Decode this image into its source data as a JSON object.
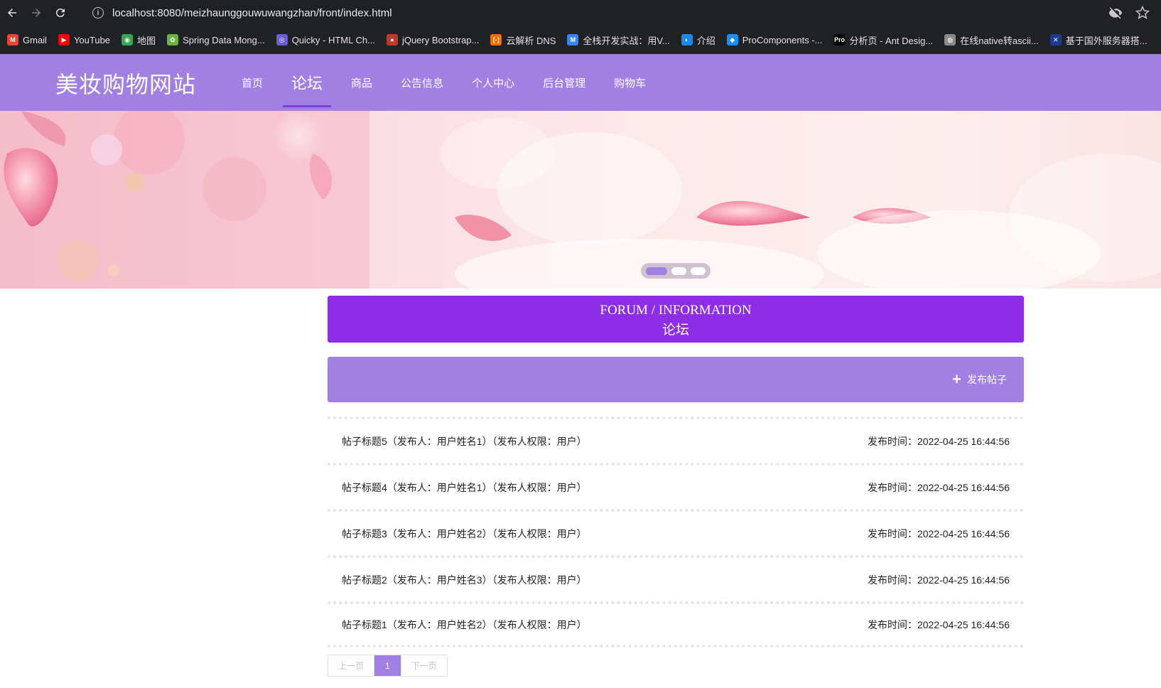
{
  "browser": {
    "url": "localhost:8080/meizhaunggouwuwangzhan/front/index.html",
    "bookmarks": [
      {
        "label": "Gmail",
        "icon": "gmail-icon",
        "color": "#ea4335",
        "glyph": "M"
      },
      {
        "label": "YouTube",
        "icon": "youtube-icon",
        "color": "#ff0000",
        "glyph": "▶"
      },
      {
        "label": "地图",
        "icon": "maps-icon",
        "color": "#34a853",
        "glyph": "◉"
      },
      {
        "label": "Spring Data Mong...",
        "icon": "spring-icon",
        "color": "#6db33f",
        "glyph": "✿"
      },
      {
        "label": "Quicky - HTML Ch...",
        "icon": "quicky-icon",
        "color": "#6b5bd6",
        "glyph": "◎"
      },
      {
        "label": "jQuery Bootstrap...",
        "icon": "jquery-icon",
        "color": "#c0392b",
        "glyph": "●"
      },
      {
        "label": "云解析 DNS",
        "icon": "aliyun-icon",
        "color": "#ff6a00",
        "glyph": "[-]"
      },
      {
        "label": "全栈开发实战：用V...",
        "icon": "m-icon",
        "color": "#3b82f6",
        "glyph": "M"
      },
      {
        "label": "介绍",
        "icon": "globe-icon",
        "color": "#1e88e5",
        "glyph": "◐"
      },
      {
        "label": "ProComponents -...",
        "icon": "procomponents-icon",
        "color": "#1890ff",
        "glyph": "◆"
      },
      {
        "label": "分析页 - Ant Desig...",
        "icon": "pro-icon",
        "color": "#000000",
        "glyph": "Pro"
      },
      {
        "label": "在线native转ascii...",
        "icon": "web-icon",
        "color": "#8a8a8a",
        "glyph": "◍"
      },
      {
        "label": "基于国外服务器搭...",
        "icon": "flag-icon",
        "color": "#1a3d8f",
        "glyph": "✕"
      }
    ]
  },
  "site": {
    "logo": "美妆购物网站",
    "nav": [
      {
        "label": "首页",
        "active": false
      },
      {
        "label": "论坛",
        "active": true
      },
      {
        "label": "商品",
        "active": false
      },
      {
        "label": "公告信息",
        "active": false
      },
      {
        "label": "个人中心",
        "active": false
      },
      {
        "label": "后台管理",
        "active": false
      },
      {
        "label": "购物车",
        "active": false
      }
    ]
  },
  "forum": {
    "title_en": "FORUM / INFORMATION",
    "title_cn": "论坛",
    "publish_label": "发布帖子",
    "posts": [
      {
        "title": "帖子标题5（发布人：用户姓名1）（发布人权限：用户）",
        "time": "发布时间：2022-04-25 16:44:56"
      },
      {
        "title": "帖子标题4（发布人：用户姓名1）（发布人权限：用户）",
        "time": "发布时间：2022-04-25 16:44:56"
      },
      {
        "title": "帖子标题3（发布人：用户姓名2）（发布人权限：用户）",
        "time": "发布时间：2022-04-25 16:44:56"
      },
      {
        "title": "帖子标题2（发布人：用户姓名3）（发布人权限：用户）",
        "time": "发布时间：2022-04-25 16:44:56"
      },
      {
        "title": "帖子标题1（发布人：用户姓名2）（发布人权限：用户）",
        "time": "发布时间：2022-04-25 16:44:56"
      }
    ]
  },
  "pager": {
    "prev": "上一页",
    "current": "1",
    "next": "下一页"
  },
  "colors": {
    "accent": "#a27fe3",
    "title_bg": "#8d2de6"
  }
}
